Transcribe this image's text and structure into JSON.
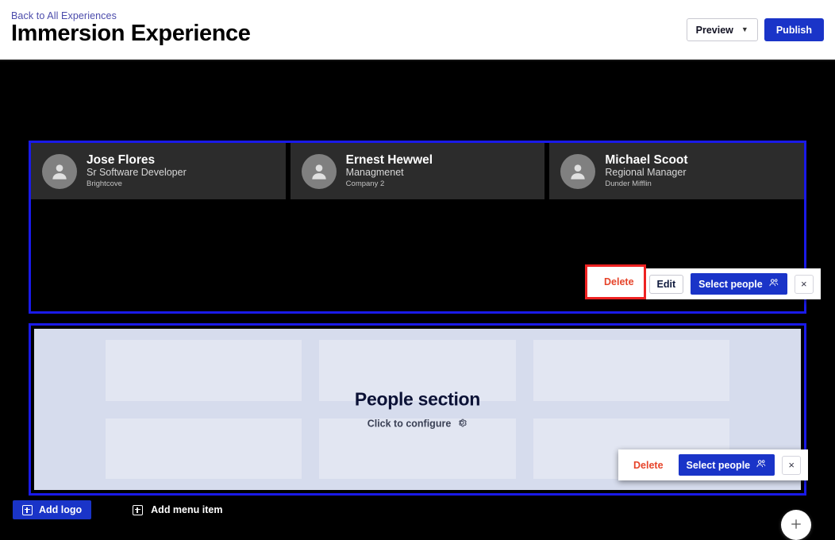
{
  "header": {
    "back_link": "Back to All Experiences",
    "title": "Immersion Experience",
    "preview_label": "Preview",
    "preview_chevron": "chevron-down-icon",
    "publish_label": "Publish"
  },
  "people_panel": {
    "cards": [
      {
        "name": "Jose Flores",
        "role": "Sr Software Developer",
        "org": "Brightcove"
      },
      {
        "name": "Ernest Hewwel",
        "role": "Managmenet",
        "org": "Company 2"
      },
      {
        "name": "Michael Scoot",
        "role": "Regional Manager",
        "org": "Dunder Mifflin"
      }
    ],
    "toolbar": {
      "delete_label": "Delete",
      "edit_label": "Edit",
      "select_people_label": "Select people",
      "select_people_icon": "people-icon",
      "close_icon": "close-icon",
      "close_label": "×"
    }
  },
  "section_panel": {
    "title": "People section",
    "subtitle": "Click to configure",
    "gear_icon": "gear-icon",
    "toolbar": {
      "delete_label": "Delete",
      "select_people_label": "Select people",
      "select_people_icon": "people-icon",
      "close_icon": "close-icon",
      "close_label": "×"
    }
  },
  "canvas": {
    "add_block_icon": "plus-icon"
  },
  "bottom_bar": {
    "add_logo_label": "Add logo",
    "add_menu_item_label": "Add menu item",
    "add_icon": "plus-square-icon"
  },
  "colors": {
    "accent_blue": "#1a34c8",
    "selection_outline": "#1a1ae8",
    "delete_red": "#e6442a",
    "highlight_red": "#ee2222",
    "link_indigo": "#4b4bab",
    "card_dark": "#2c2c2c",
    "section_bg": "#d6dced",
    "placeholder": "#e2e6f2"
  }
}
